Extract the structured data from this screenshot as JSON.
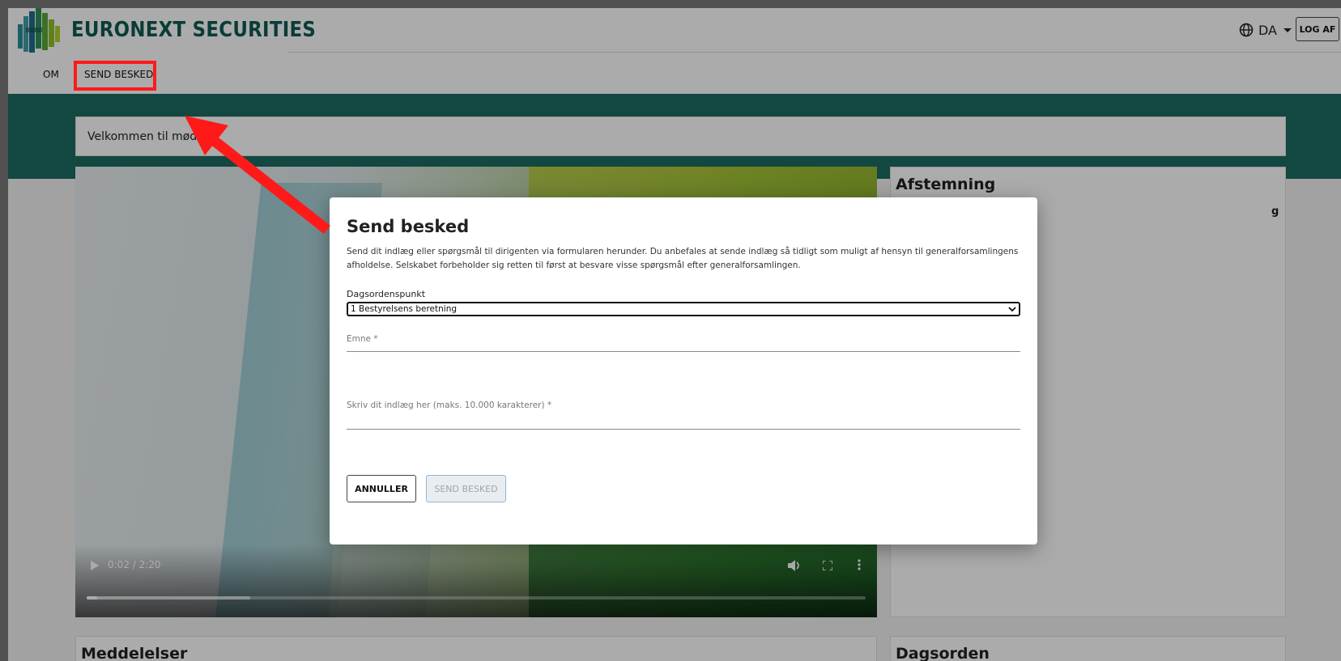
{
  "header": {
    "brand": "EURONEXT SECURITIES",
    "language": "DA",
    "logout_label": "LOG AF"
  },
  "nav": {
    "items": [
      {
        "label": "OM"
      },
      {
        "label": "SEND BESKED"
      }
    ]
  },
  "welcome": {
    "text": "Velkommen til mødet"
  },
  "video": {
    "time": "0:02 / 2:20",
    "progress_fraction": 0.014,
    "buffered_fraction": 0.21
  },
  "panels": {
    "voting_title": "Afstemning",
    "voting_subtext": "g",
    "messages_title": "Meddelelser",
    "agenda_title": "Dagsorden"
  },
  "modal": {
    "title": "Send besked",
    "description": "Send dit indlæg eller spørgsmål til dirigenten via formularen herunder. Du anbefales at sende indlæg så tidligt som muligt af hensyn til generalforsamlingens afholdelse. Selskabet forbeholder sig retten til først at besvare visse spørgsmål efter generalforsamlingen.",
    "agenda_label": "Dagsordenspunkt",
    "agenda_selected": "1 Bestyrelsens beretning",
    "subject_placeholder": "Emne *",
    "message_placeholder": "Skriv dit indlæg her (maks. 10.000 karakterer) *",
    "cancel_label": "ANNULLER",
    "send_label": "SEND BESKED"
  },
  "colors": {
    "brand_teal": "#1d6b61",
    "brand_text": "#0f5a52",
    "annotation_red": "#ff1a1a"
  }
}
